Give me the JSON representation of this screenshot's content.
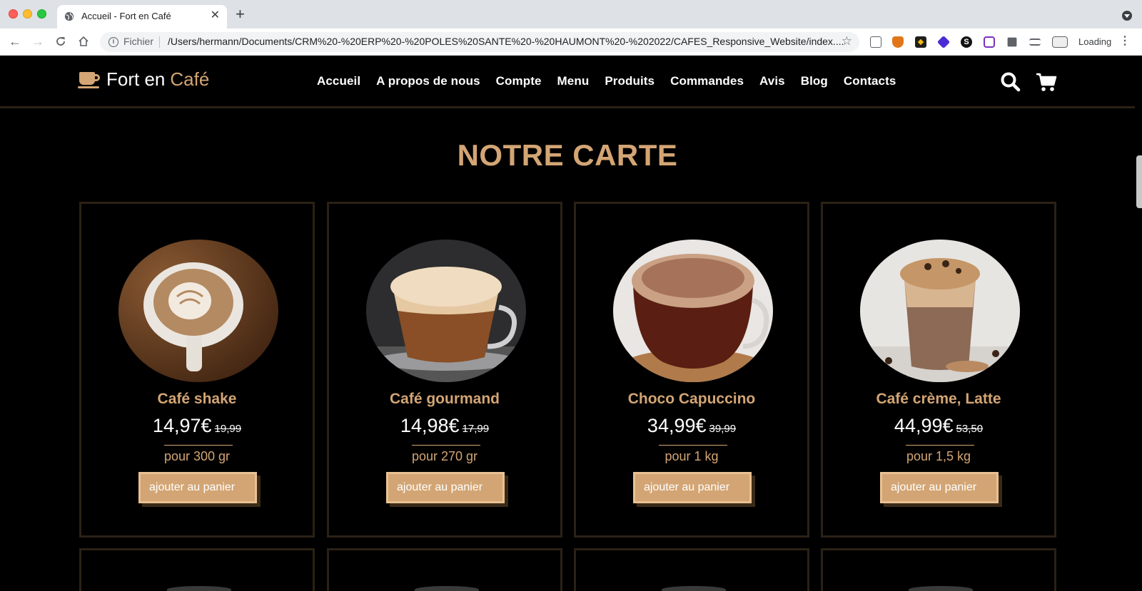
{
  "browser": {
    "tab_title": "Accueil - Fort en Café",
    "new_tab": "+",
    "scheme_label": "Fichier",
    "url": "/Users/hermann/Documents/CRM%20-%20ERP%20-%20POLES%20SANTE%20-%20HAUMONT%20-%202022/CAFES_Responsive_Website/index....",
    "status": "Loading",
    "extension_icons": [
      "cube-extension-icon",
      "fox-extension-icon",
      "binance-extension-icon",
      "diamond-extension-icon",
      "s-extension-icon",
      "hexagon-extension-icon",
      "puzzle-extension-icon",
      "media-extension-icon",
      "profile-extension-icon"
    ]
  },
  "site": {
    "brand": "Fort en",
    "brand_accent": "Café",
    "nav": [
      "Accueil",
      "A propos de nous",
      "Compte",
      "Menu",
      "Produits",
      "Commandes",
      "Avis",
      "Blog",
      "Contacts"
    ],
    "section_title": "NOTRE CARTE",
    "accent_color": "#d3a574",
    "products": [
      {
        "name": "Café shake",
        "price": "14,97€",
        "old_price": "19,99",
        "weight": "pour 300 gr",
        "cta": "ajouter au panier"
      },
      {
        "name": "Café gourmand",
        "price": "14,98€",
        "old_price": "17,99",
        "weight": "pour 270 gr",
        "cta": "ajouter au panier"
      },
      {
        "name": "Choco Capuccino",
        "price": "34,99€",
        "old_price": "39,99",
        "weight": "pour 1 kg",
        "cta": "ajouter au panier"
      },
      {
        "name": "Café crème, Latte",
        "price": "44,99€",
        "old_price": "53,50",
        "weight": "pour 1,5 kg",
        "cta": "ajouter au panier"
      }
    ]
  }
}
